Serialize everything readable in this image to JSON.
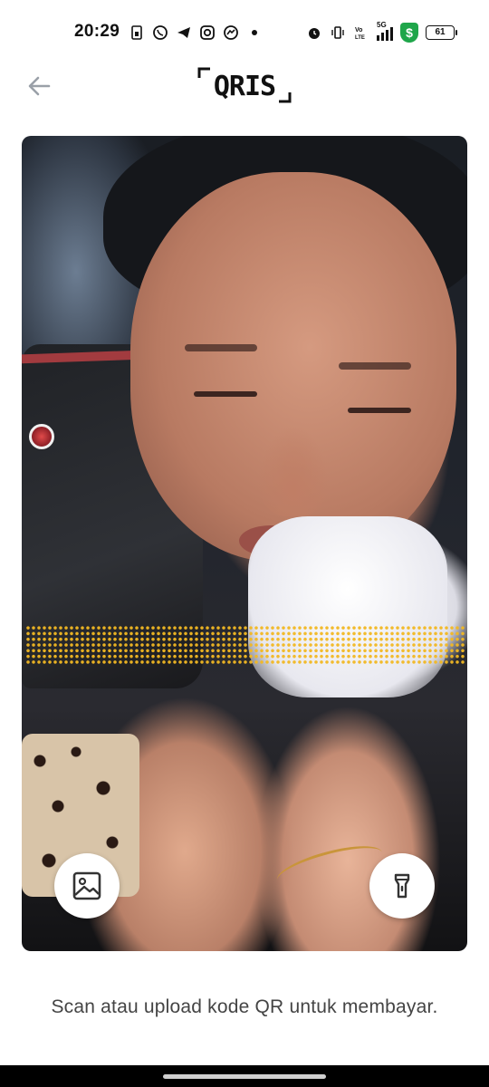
{
  "status_bar": {
    "time": "20:29",
    "battery": "61",
    "shield_label": "$",
    "network": "5G",
    "left_icons": [
      "sim-icon",
      "whatsapp-icon",
      "telegram-icon",
      "instagram-icon",
      "messenger-icon"
    ],
    "right_icons": [
      "alarm-icon",
      "vibrate-icon",
      "volte-icon",
      "signal-icon",
      "security-shield-icon",
      "battery-icon"
    ]
  },
  "header": {
    "logo_text": "QRIS",
    "back_icon": "back-arrow-icon"
  },
  "scanner": {
    "gallery_icon": "image-gallery-icon",
    "torch_icon": "flashlight-icon",
    "scan_color": "#f2b822"
  },
  "instruction": "Scan atau upload kode QR untuk membayar."
}
